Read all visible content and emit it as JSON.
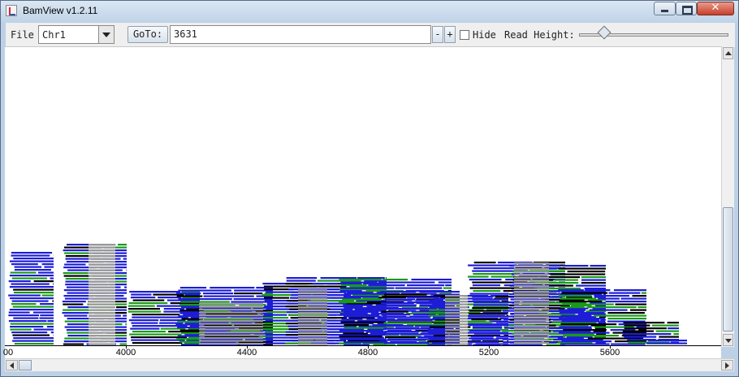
{
  "window": {
    "title": "BamView v1.2.11",
    "close_glyph": "✕"
  },
  "toolbar": {
    "file_label": "File",
    "sequence_selected": "Chr1",
    "goto_label": "GoTo:",
    "goto_value": "3631",
    "minus_label": "-",
    "plus_label": "+",
    "hide_label": "Hide",
    "hide_checked": false,
    "read_height_label": "Read Height:",
    "read_height_fraction": 0.19
  },
  "axis": {
    "start_label": "00",
    "ticks": [
      "4000",
      "4400",
      "4800",
      "5200",
      "5600"
    ]
  },
  "colors": {
    "read_blue": "#1d1dd6",
    "read_green": "#1a9a1a",
    "read_gray": "#999999",
    "read_black": "#000000"
  },
  "icons": {
    "app": "java-app-icon",
    "minimize": "minimize-icon",
    "maximize": "maximize-icon",
    "close": "close-icon",
    "dropdown": "chevron-down-icon"
  }
}
